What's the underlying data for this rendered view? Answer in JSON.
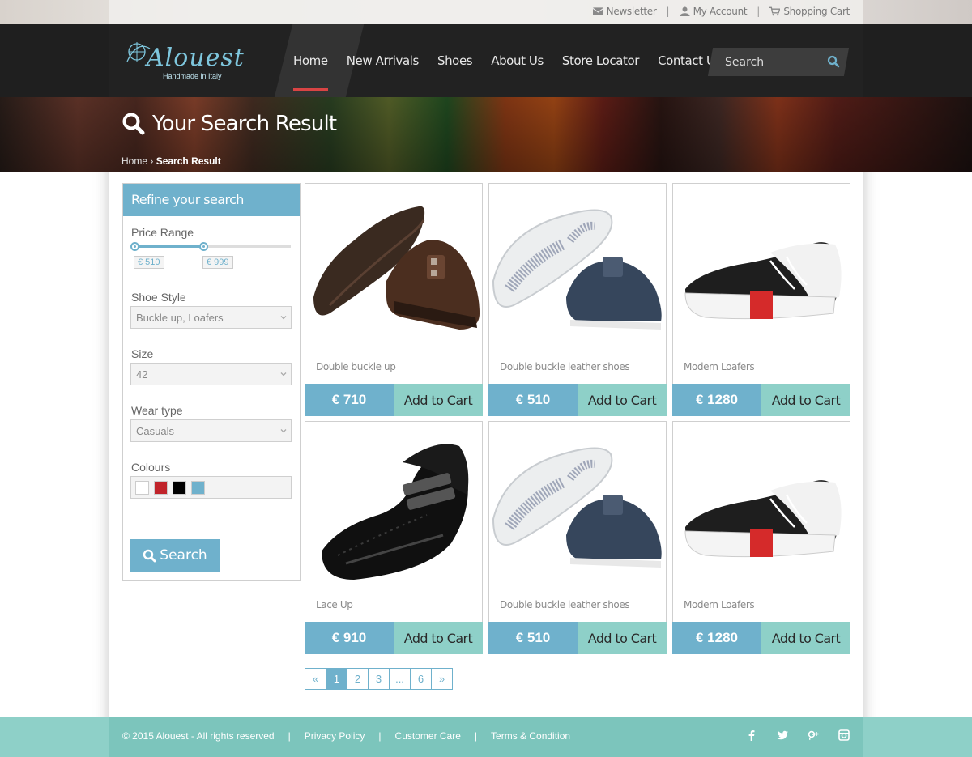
{
  "topbar": {
    "newsletter": "Newsletter",
    "account": "My Account",
    "cart": "Shopping Cart"
  },
  "logo": {
    "brand": "Alouest",
    "tagline": "Handmade in Italy"
  },
  "nav": {
    "items": [
      {
        "label": "Home"
      },
      {
        "label": "New Arrivals"
      },
      {
        "label": "Shoes"
      },
      {
        "label": "About Us"
      },
      {
        "label": "Store Locator"
      },
      {
        "label": "Contact Us"
      }
    ]
  },
  "search": {
    "placeholder": "Search"
  },
  "banner": {
    "title": "Your Search Result"
  },
  "breadcrumb": {
    "home": "Home",
    "current": "Search Result"
  },
  "sidebar": {
    "heading": "Refine your search",
    "price_label": "Price Range",
    "price_min": "€ 510",
    "price_max": "€ 999",
    "style_label": "Shoe Style",
    "style_value": "Buckle up, Loafers",
    "size_label": "Size",
    "size_value": "42",
    "wear_label": "Wear type",
    "wear_value": "Casuals",
    "colours_label": "Colours",
    "colours": [
      "#ffffff",
      "#c0232a",
      "#000000",
      "#6fb1cc"
    ],
    "search_button": "Search"
  },
  "products": [
    {
      "name": "Double buckle up",
      "price": "€ 710",
      "cart": "Add to Cart"
    },
    {
      "name": "Double buckle leather shoes",
      "price": "€ 510",
      "cart": "Add to Cart"
    },
    {
      "name": "Modern Loafers",
      "price": "€ 1280",
      "cart": "Add to Cart"
    },
    {
      "name": "Lace Up",
      "price": "€ 910",
      "cart": "Add to Cart"
    },
    {
      "name": "Double buckle leather shoes",
      "price": "€ 510",
      "cart": "Add to Cart"
    },
    {
      "name": "Modern Loafers",
      "price": "€ 1280",
      "cart": "Add to Cart"
    }
  ],
  "pagination": {
    "first": "«",
    "pages": [
      "1",
      "2",
      "3",
      "...",
      "6"
    ],
    "last": "»",
    "current": "1"
  },
  "footer": {
    "copyright": "© 2015 Alouest - All rights reserved",
    "privacy": "Privacy Policy",
    "care": "Customer Care",
    "terms": "Terms & Condition"
  },
  "colors": {
    "accent": "#6fb1cc",
    "teal": "#8ed0c8",
    "nav_active": "#d94444",
    "header_bg": "#222222"
  }
}
